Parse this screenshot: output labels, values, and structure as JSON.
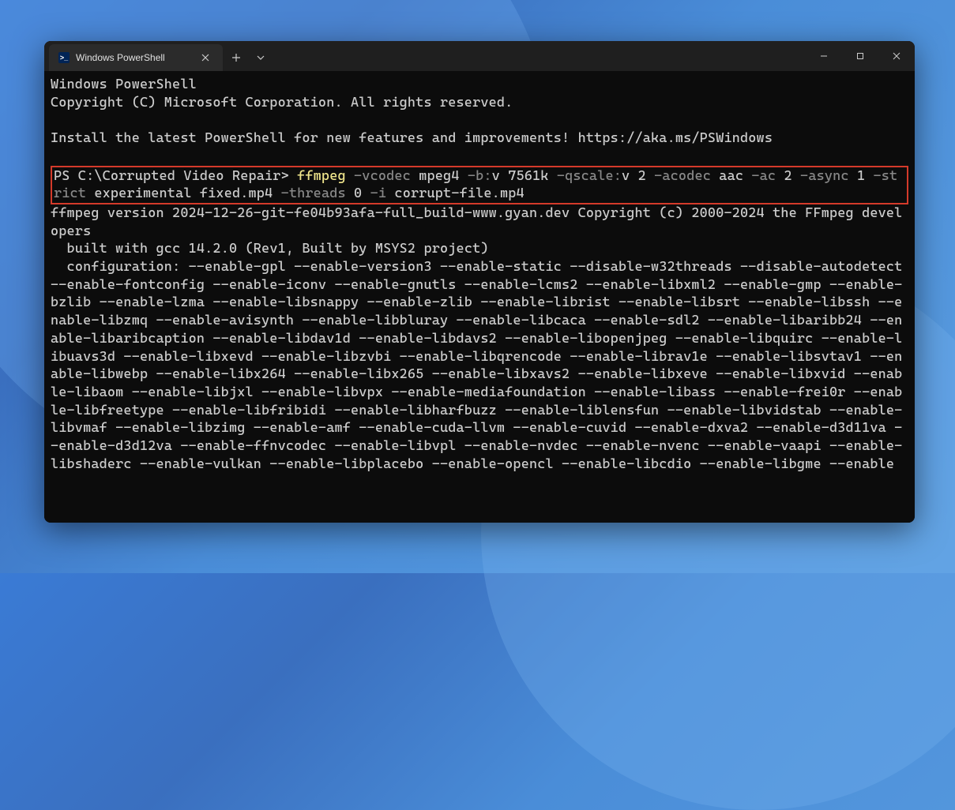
{
  "titlebar": {
    "tab_title": "Windows PowerShell",
    "tab_icon_text": ">_"
  },
  "terminal": {
    "line1": "Windows PowerShell",
    "line2": "Copyright (C) Microsoft Corporation. All rights reserved.",
    "install_msg": "Install the latest PowerShell for new features and improvements! https://aka.ms/PSWindows",
    "prompt_prefix": "PS C:\\Corrupted Video Repair> ",
    "cmd_ffmpeg": "ffmpeg",
    "o_vcodec": "-vcodec",
    "a_mpeg4": " mpeg4 ",
    "o_b": "-b:",
    "a_v": "v ",
    "n_7561k": "7561k",
    "sp1": " ",
    "o_qscale": "-qscale:",
    "a_v2": "v ",
    "n_2": "2",
    "sp2": " ",
    "o_acodec": "-acodec",
    "a_aac": " aac ",
    "o_ac": "-ac",
    "sp3": " ",
    "n_2b": "2",
    "sp4": " ",
    "o_async": "-async",
    "sp5": " ",
    "n_1": "1",
    "sp6": " ",
    "o_strict": "-strict",
    "a_exp": " experimental fixed.mp4 ",
    "o_threads": "-threads",
    "sp7": " ",
    "n_0": "0",
    "sp8": " ",
    "o_i": "-i",
    "a_corrupt": " corrupt-file.mp4",
    "version_line": "ffmpeg version 2024-12-26-git-fe04b93afa-full_build-www.gyan.dev Copyright (c) 2000-2024 the FFmpeg developers",
    "built_line": "  built with gcc 14.2.0 (Rev1, Built by MSYS2 project)",
    "config_line": "  configuration: --enable-gpl --enable-version3 --enable-static --disable-w32threads --disable-autodetect --enable-fontconfig --enable-iconv --enable-gnutls --enable-lcms2 --enable-libxml2 --enable-gmp --enable-bzlib --enable-lzma --enable-libsnappy --enable-zlib --enable-librist --enable-libsrt --enable-libssh --enable-libzmq --enable-avisynth --enable-libbluray --enable-libcaca --enable-sdl2 --enable-libaribb24 --enable-libaribcaption --enable-libdav1d --enable-libdavs2 --enable-libopenjpeg --enable-libquirc --enable-libuavs3d --enable-libxevd --enable-libzvbi --enable-libqrencode --enable-librav1e --enable-libsvtav1 --enable-libwebp --enable-libx264 --enable-libx265 --enable-libxavs2 --enable-libxeve --enable-libxvid --enable-libaom --enable-libjxl --enable-libvpx --enable-mediafoundation --enable-libass --enable-frei0r --enable-libfreetype --enable-libfribidi --enable-libharfbuzz --enable-liblensfun --enable-libvidstab --enable-libvmaf --enable-libzimg --enable-amf --enable-cuda-llvm --enable-cuvid --enable-dxva2 --enable-d3d11va --enable-d3d12va --enable-ffnvcodec --enable-libvpl --enable-nvdec --enable-nvenc --enable-vaapi --enable-libshaderc --enable-vulkan --enable-libplacebo --enable-opencl --enable-libcdio --enable-libgme --enable"
  }
}
